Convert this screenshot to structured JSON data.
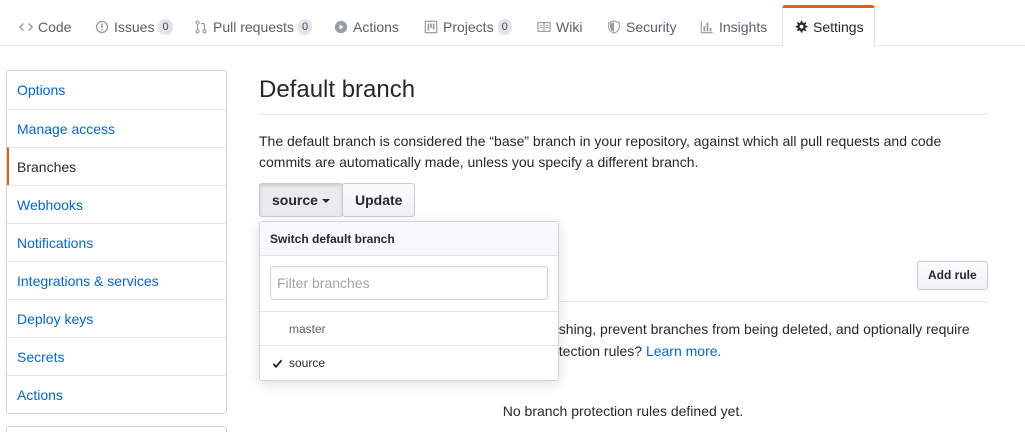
{
  "tabs": [
    {
      "label": "Code",
      "icon": "code-icon"
    },
    {
      "label": "Issues",
      "icon": "issue-icon",
      "count": "0"
    },
    {
      "label": "Pull requests",
      "icon": "pull-request-icon",
      "count": "0"
    },
    {
      "label": "Actions",
      "icon": "play-icon"
    },
    {
      "label": "Projects",
      "icon": "project-icon",
      "count": "0"
    },
    {
      "label": "Wiki",
      "icon": "book-icon"
    },
    {
      "label": "Security",
      "icon": "shield-icon"
    },
    {
      "label": "Insights",
      "icon": "graph-icon"
    },
    {
      "label": "Settings",
      "icon": "gear-icon",
      "selected": true
    }
  ],
  "sidebar": {
    "items": [
      {
        "label": "Options"
      },
      {
        "label": "Manage access"
      },
      {
        "label": "Branches",
        "selected": true
      },
      {
        "label": "Webhooks"
      },
      {
        "label": "Notifications"
      },
      {
        "label": "Integrations & services"
      },
      {
        "label": "Deploy keys"
      },
      {
        "label": "Secrets"
      },
      {
        "label": "Actions"
      }
    ]
  },
  "main": {
    "title": "Default branch",
    "description": "The default branch is considered the “base” branch in your repository, against which all pull requests and code commits are automatically made, unless you specify a different branch.",
    "branch_select_label": "source",
    "update_label": "Update",
    "add_rule_label": "Add rule",
    "protection_text_1": "ushing, prevent branches from being deleted, and optionally require",
    "protection_text_2": "otection rules?",
    "learn_more": "Learn more.",
    "empty_text": "No branch protection rules defined yet."
  },
  "dropdown": {
    "header": "Switch default branch",
    "filter_placeholder": "Filter branches",
    "filter_value": "",
    "items": [
      {
        "label": "master",
        "selected": false
      },
      {
        "label": "source",
        "selected": true
      }
    ]
  },
  "colors": {
    "accent": "#e36209",
    "link": "#0366d6",
    "text": "#24292e",
    "muted": "#586069",
    "border": "#e1e4e8"
  }
}
